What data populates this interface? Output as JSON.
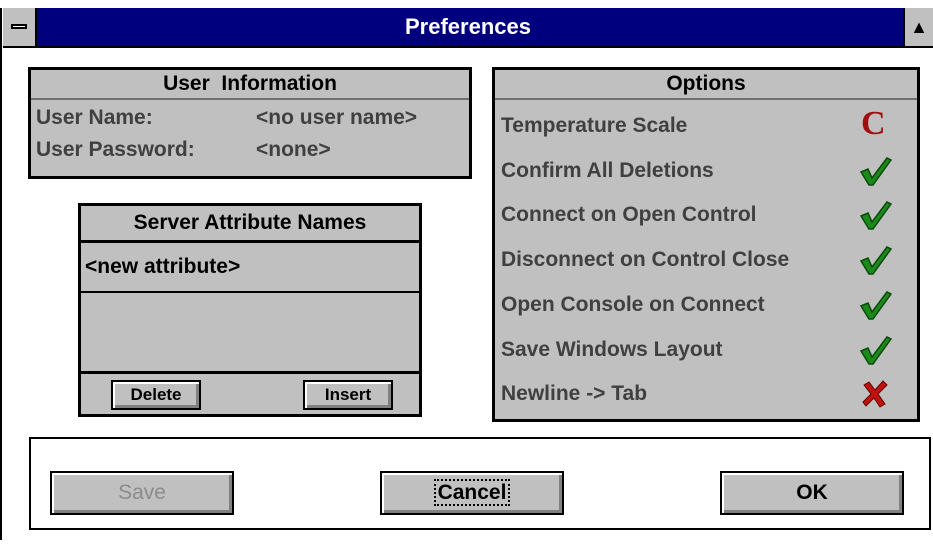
{
  "window": {
    "title": "Preferences"
  },
  "user_information": {
    "header": "User  Information",
    "user_name_label": "User Name:",
    "user_name_value": "<no user name>",
    "user_password_label": "User Password:",
    "user_password_value": "<none>"
  },
  "server_attributes": {
    "header": "Server Attribute Names",
    "items": [
      "<new attribute>"
    ],
    "delete_label": "Delete",
    "insert_label": "Insert"
  },
  "options": {
    "header": "Options",
    "items": [
      {
        "label": "Temperature Scale",
        "mark": "C",
        "mark_type": "letter",
        "color": "#a01010"
      },
      {
        "label": "Confirm All Deletions",
        "mark": "check",
        "mark_type": "check",
        "color": "#1a8a1a"
      },
      {
        "label": "Connect on Open Control",
        "mark": "check",
        "mark_type": "check",
        "color": "#1a8a1a"
      },
      {
        "label": "Disconnect on Control Close",
        "mark": "check",
        "mark_type": "check",
        "color": "#1a8a1a"
      },
      {
        "label": "Open Console on Connect",
        "mark": "check",
        "mark_type": "check",
        "color": "#1a8a1a"
      },
      {
        "label": "Save Windows Layout",
        "mark": "check",
        "mark_type": "check",
        "color": "#1a8a1a"
      },
      {
        "label": "Newline -> Tab",
        "mark": "cross",
        "mark_type": "cross",
        "color": "#c01010"
      }
    ]
  },
  "buttons": {
    "save": "Save",
    "cancel": "Cancel",
    "ok": "OK"
  },
  "colors": {
    "title_bar": "#00007f",
    "panel": "#c0c0c0"
  }
}
